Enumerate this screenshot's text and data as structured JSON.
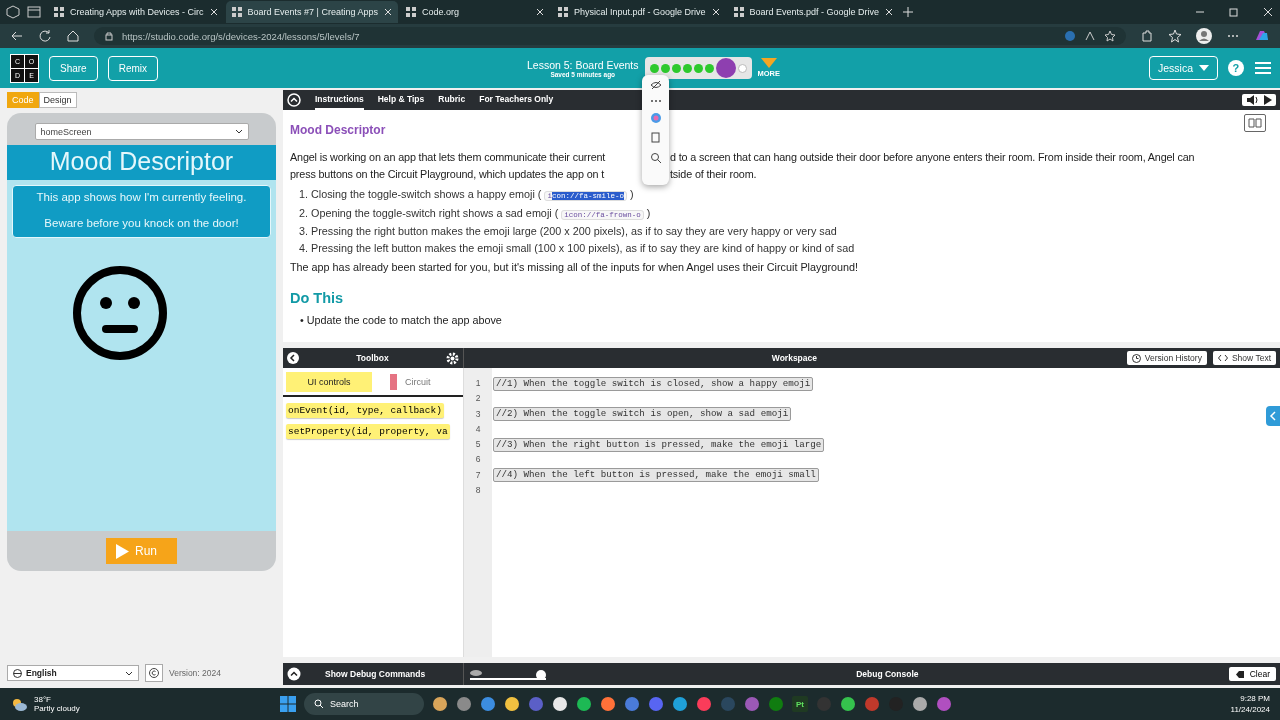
{
  "browser": {
    "tabs": [
      {
        "title": "Creating Apps with Devices - Circ",
        "selected": false
      },
      {
        "title": "Board Events #7 | Creating Apps",
        "selected": true
      },
      {
        "title": "Code.org",
        "selected": false
      },
      {
        "title": "Physical Input.pdf - Google Drive",
        "selected": false
      },
      {
        "title": "Board Events.pdf - Google Drive",
        "selected": false
      }
    ],
    "url": "https://studio.code.org/s/devices-2024/lessons/5/levels/7"
  },
  "header": {
    "logo": [
      "C",
      "O",
      "D",
      "E"
    ],
    "buttons": [
      "Share",
      "Remix"
    ],
    "lesson_title": "Lesson 5: Board Events",
    "saved": "Saved 5 minutes ago",
    "progress": [
      {
        "kind": "done"
      },
      {
        "kind": "done"
      },
      {
        "kind": "done"
      },
      {
        "kind": "done"
      },
      {
        "kind": "done"
      },
      {
        "kind": "done"
      },
      {
        "kind": "current"
      },
      {
        "kind": "todo"
      }
    ],
    "more": "MORE",
    "user": "Jessica",
    "help": "?"
  },
  "left": {
    "modes": [
      {
        "label": "Code",
        "selected": true
      },
      {
        "label": "Design",
        "selected": false
      }
    ],
    "screen_select": "homeScreen",
    "app_title": "Mood Descriptor",
    "app_text": [
      "This app shows how I'm currently feeling.",
      "Beware before you knock on the door!"
    ],
    "run": "Run",
    "language": "English",
    "version": "Version: 2024"
  },
  "instructions": {
    "tabs": [
      {
        "label": "Instructions",
        "selected": true
      },
      {
        "label": "Help & Tips",
        "selected": false
      },
      {
        "label": "Rubric",
        "selected": false
      },
      {
        "label": "For Teachers Only",
        "selected": false
      }
    ],
    "title": "Mood Descriptor",
    "intro_lines": [
      {
        "before": "Angel is working on an app that lets them communicate their current",
        "after": "d to a screen that can hang outside their door before anyone enters their room. From inside their room, Angel can"
      },
      {
        "before": "press buttons on the Circuit Playground, which updates the app on t",
        "after": "tside of their room."
      }
    ],
    "steps": [
      {
        "number": "1.",
        "before": "Closing the toggle-switch shows a happy emoji (",
        "code_parts": [
          {
            "text": "i",
            "selected": false
          },
          {
            "text": "con://fa-smile-o",
            "selected": true
          }
        ],
        "after": ")"
      },
      {
        "number": "2.",
        "before": "Opening the toggle-switch right shows a sad emoji (",
        "code_parts": [
          {
            "text": "icon://fa-frown-o",
            "selected": false
          }
        ],
        "after": ")"
      },
      {
        "number": "3.",
        "before": "Pressing the right button makes the emoji large (200 x 200 pixels), as if to say they are very happy or very sad"
      },
      {
        "number": "4.",
        "before": "Pressing the left button makes the emoji small (100 x 100 pixels), as if to say they are kind of happy or kind of sad"
      }
    ],
    "closing": "The app has already been started for you, but it's missing all of the inputs for when Angel uses their Circuit Playground!",
    "do_this_title": "Do This",
    "do_this": [
      {
        "bullet": "•",
        "text": "Update the code to match the app above"
      }
    ]
  },
  "toolbox": {
    "title": "Toolbox",
    "categories": [
      {
        "label": "UI controls",
        "selected": true,
        "color": "#fff176"
      },
      {
        "label": "Circuit",
        "selected": false,
        "color": "#e57383"
      }
    ],
    "blocks": [
      "onEvent(id, type, callback)",
      "setProperty(id, property, va"
    ]
  },
  "workspace": {
    "title": "Workspace",
    "buttons": [
      "Version History",
      "Show Text"
    ],
    "lines": [
      {
        "number": "1",
        "code": "//1) When the toggle switch is closed, show a happy emoji"
      },
      {
        "number": "2"
      },
      {
        "number": "3",
        "code": "//2) When the toggle switch is open, show a sad emoji"
      },
      {
        "number": "4"
      },
      {
        "number": "5",
        "code": "//3) When the right button is pressed, make the emoji large"
      },
      {
        "number": "6"
      },
      {
        "number": "7",
        "code": "//4) When the left button is pressed, make the emoji small"
      },
      {
        "number": "8"
      }
    ]
  },
  "debug": {
    "toggle": "Show Debug Commands",
    "speed_slider": {
      "level": 1
    },
    "console": "Debug Console",
    "clear": "Clear"
  },
  "taskbar": {
    "temperature": "38°F",
    "weather": "Partly cloudy",
    "search": "Search",
    "app_label": "Pt",
    "time": "9:28 PM",
    "date": "11/24/2024"
  }
}
